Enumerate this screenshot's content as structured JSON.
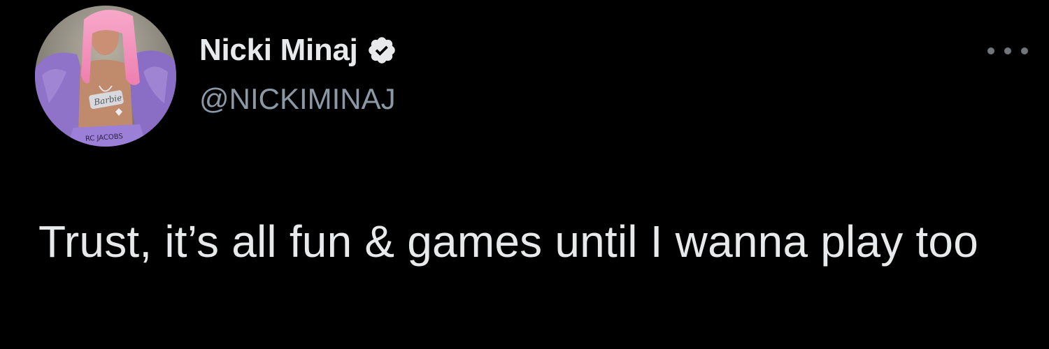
{
  "tweet": {
    "author": {
      "display_name": "Nicki Minaj",
      "handle": "@NICKIMINAJ",
      "verified": true,
      "verified_icon": "verified-badge-icon",
      "avatar": "profile-avatar"
    },
    "more_icon": "more-options-icon",
    "text": "Trust, it’s all fun & games until I wanna play too"
  },
  "colors": {
    "background": "#000000",
    "primary_text": "#e7e9ea",
    "secondary_text": "#8b98a5",
    "icon_gray": "#71767b"
  }
}
